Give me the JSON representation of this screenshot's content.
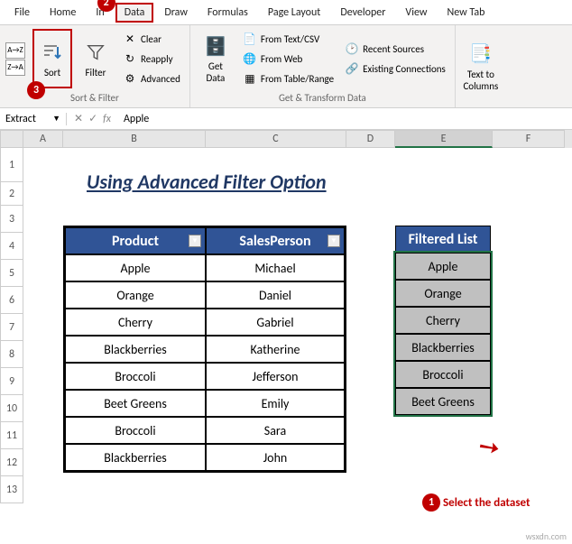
{
  "tabs": {
    "file": "File",
    "home": "Home",
    "insert_partial": "In",
    "data": "Data",
    "draw": "Draw",
    "formulas": "Formulas",
    "page_layout": "Page Layout",
    "developer": "Developer",
    "view": "View",
    "new_tab": "New Tab"
  },
  "ribbon": {
    "sort_group_label": "Sort & Filter",
    "sort_az": "A→Z",
    "sort_za": "Z→A",
    "sort": "Sort",
    "filter": "Filter",
    "clear": "Clear",
    "reapply": "Reapply",
    "advanced": "Advanced",
    "getdata": "Get\nData",
    "from_text_csv": "From Text/CSV",
    "from_web": "From Web",
    "from_table": "From Table/Range",
    "recent_sources": "Recent Sources",
    "existing_conn": "Existing Connections",
    "transform_label": "Get & Transform Data",
    "text_to_cols": "Text to\nColumns"
  },
  "fbar": {
    "name": "Extract",
    "value": "Apple"
  },
  "cols": {
    "A": "A",
    "B": "B",
    "C": "C",
    "D": "D",
    "E": "E",
    "F": "F"
  },
  "rows": [
    "1",
    "2",
    "3",
    "4",
    "5",
    "6",
    "7",
    "8",
    "9",
    "10",
    "11",
    "12",
    "13"
  ],
  "title": "Using Advanced Filter Option",
  "table": {
    "headers": {
      "product": "Product",
      "sales": "SalesPerson"
    },
    "rows": [
      {
        "product": "Apple",
        "sales": "Michael"
      },
      {
        "product": "Orange",
        "sales": "Daniel"
      },
      {
        "product": "Cherry",
        "sales": "Gabriel"
      },
      {
        "product": "Blackberries",
        "sales": "Katherine"
      },
      {
        "product": "Broccoli",
        "sales": "Jefferson"
      },
      {
        "product": "Beet Greens",
        "sales": "Emily"
      },
      {
        "product": "Broccoli",
        "sales": "Sara"
      },
      {
        "product": "Blackberries",
        "sales": "John"
      }
    ]
  },
  "filtered": {
    "header": "Filtered List",
    "items": [
      "Apple",
      "Orange",
      "Cherry",
      "Blackberries",
      "Broccoli",
      "Beet Greens"
    ]
  },
  "annotations": {
    "step1": "Select the dataset",
    "n1": "1",
    "n2": "2",
    "n3": "3"
  }
}
